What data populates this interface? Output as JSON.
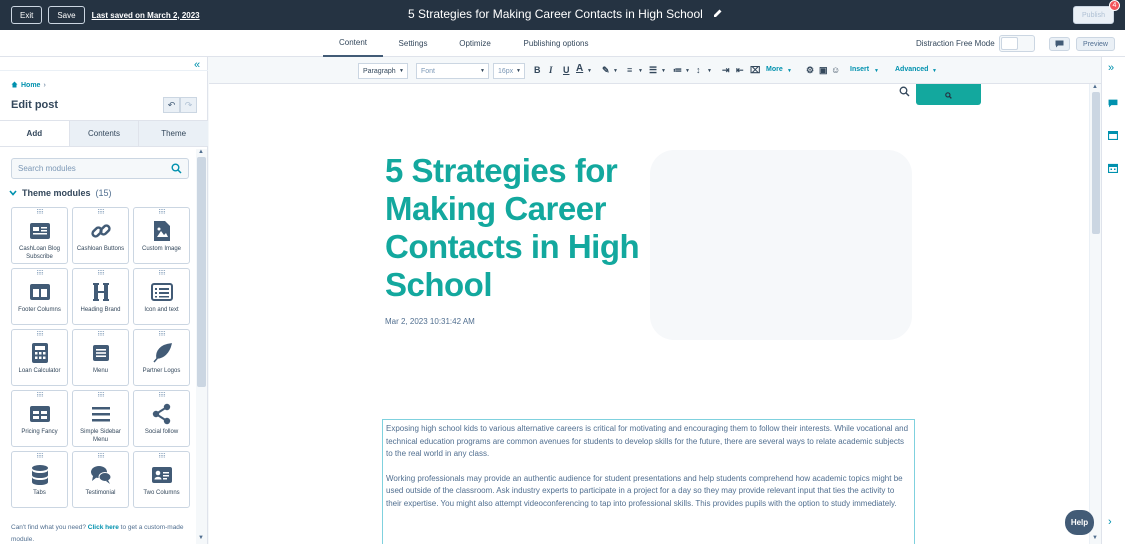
{
  "topbar": {
    "exit_label": "Exit",
    "save_label": "Save",
    "last_saved": "Last saved on March 2, 2023",
    "doc_title": "5 Strategies for Making Career Contacts in High School",
    "publish_label": "Publish",
    "notification_count": "4"
  },
  "tabs": [
    {
      "label": "Content",
      "active": true
    },
    {
      "label": "Settings",
      "active": false
    },
    {
      "label": "Optimize",
      "active": false
    },
    {
      "label": "Publishing options",
      "active": false
    }
  ],
  "header_right": {
    "distraction_free_label": "Distraction Free Mode",
    "preview_label": "Preview"
  },
  "sidebar": {
    "breadcrumb": "Home",
    "edit_post_label": "Edit post",
    "tabs": [
      {
        "label": "Add",
        "active": true
      },
      {
        "label": "Contents",
        "active": false
      },
      {
        "label": "Theme",
        "active": false
      }
    ],
    "search_placeholder": "Search modules",
    "theme_modules_label": "Theme modules",
    "theme_modules_count": "(15)",
    "modules": [
      {
        "label": "CashLoan Blog Subscribe",
        "icon": "newsletter-icon"
      },
      {
        "label": "Cashloan Buttons",
        "icon": "link-icon"
      },
      {
        "label": "Custom Image",
        "icon": "image-file-icon"
      },
      {
        "label": "Footer Columns",
        "icon": "columns-icon"
      },
      {
        "label": "Heading Brand",
        "icon": "heading-icon"
      },
      {
        "label": "Icon and text",
        "icon": "list-icon"
      },
      {
        "label": "Loan Calculator",
        "icon": "calculator-icon"
      },
      {
        "label": "Menu",
        "icon": "menu-icon"
      },
      {
        "label": "Partner Logos",
        "icon": "feather-icon"
      },
      {
        "label": "Pricing Fancy",
        "icon": "pricing-table-icon"
      },
      {
        "label": "Simple Sidebar Menu",
        "icon": "hamburger-icon"
      },
      {
        "label": "Social follow",
        "icon": "share-icon"
      },
      {
        "label": "Tabs",
        "icon": "database-icon"
      },
      {
        "label": "Testimonial",
        "icon": "chat-bubbles-icon"
      },
      {
        "label": "Two Columns",
        "icon": "contact-card-icon"
      }
    ],
    "footer_text_before": "Can't find what you need?",
    "footer_link": "Click here",
    "footer_text_after": "to get a custom-made module."
  },
  "toolbar": {
    "paragraph": "Paragraph",
    "font": "Font",
    "size": "16px",
    "more_label": "More",
    "insert_label": "Insert",
    "advanced_label": "Advanced"
  },
  "canvas": {
    "title": "5 Strategies for Making Career Contacts in High School",
    "date": "Mar 2, 2023 10:31:42 AM",
    "paragraphs": [
      "Exposing high school kids to various alternative careers is critical for motivating and encouraging them to follow their interests. While vocational and technical education programs are common avenues for students to develop skills for the future, there are several ways to relate academic subjects to the real world in any class.",
      "Working professionals may provide an authentic audience for student presentations and help students comprehend how academic topics might be used outside of the classroom. Ask industry experts to participate in a project for a day so they may provide relevant input that ties the activity to their expertise. You might also attempt videoconferencing to tap into professional skills. This provides pupils with the option to study immediately."
    ]
  },
  "help_label": "Help",
  "colors": {
    "topbar": "#253342",
    "accent_teal": "#13a89e",
    "link": "#0091ae"
  }
}
